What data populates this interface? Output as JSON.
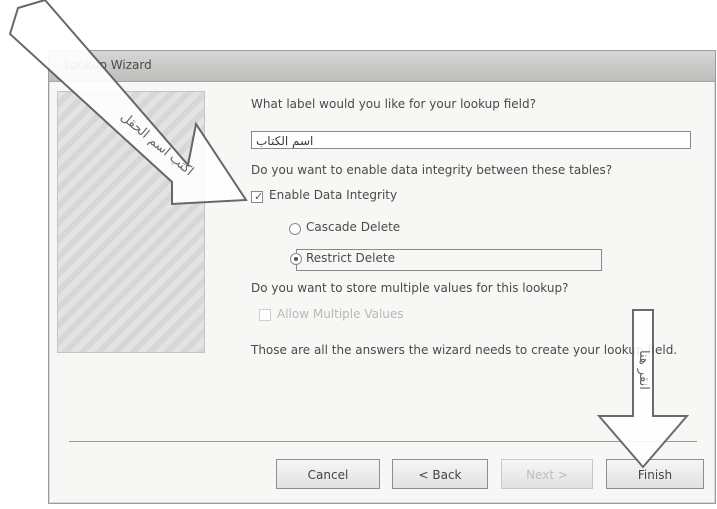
{
  "window": {
    "title": "Lookup Wizard"
  },
  "questions": {
    "label_question": "What label would you like for your lookup field?",
    "label_value": "اسم الكتاب",
    "integrity_question": "Do you want to enable data integrity between these tables?",
    "enable_integrity": "Enable Data Integrity",
    "cascade_delete": "Cascade Delete",
    "restrict_delete": "Restrict Delete",
    "multiple_question": "Do you want to store multiple values for this lookup?",
    "allow_multiple": "Allow Multiple Values",
    "summary": "Those are all the answers the wizard needs to create your lookup field."
  },
  "buttons": {
    "cancel": "Cancel",
    "back": "< Back",
    "next": "Next >",
    "finish": "Finish"
  },
  "annotations": {
    "arrow1": "اكتب اسم الحقل",
    "arrow2": "انقر هنا"
  }
}
